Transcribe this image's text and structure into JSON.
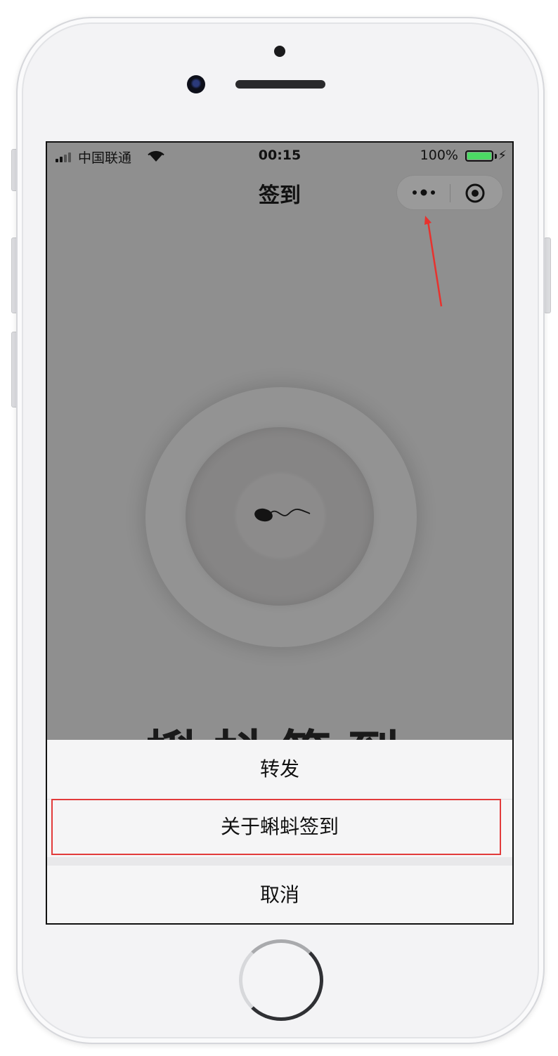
{
  "status_bar": {
    "carrier": "中国联通",
    "time": "00:15",
    "battery": "100%"
  },
  "nav": {
    "title": "签到"
  },
  "main": {
    "big_title": "蝌蚪签到"
  },
  "action_sheet": {
    "items": [
      {
        "label": "转发"
      },
      {
        "label": "关于蝌蚪签到"
      },
      {
        "label": "取消"
      }
    ]
  },
  "colors": {
    "screen_bg": "#8f8f8f",
    "battery_fill": "#4cd964",
    "highlight": "#e23b3b"
  },
  "icons": [
    "signal-icon",
    "wifi-icon",
    "battery-icon",
    "bolt-icon",
    "more-icon",
    "target-icon",
    "tadpole-icon"
  ]
}
